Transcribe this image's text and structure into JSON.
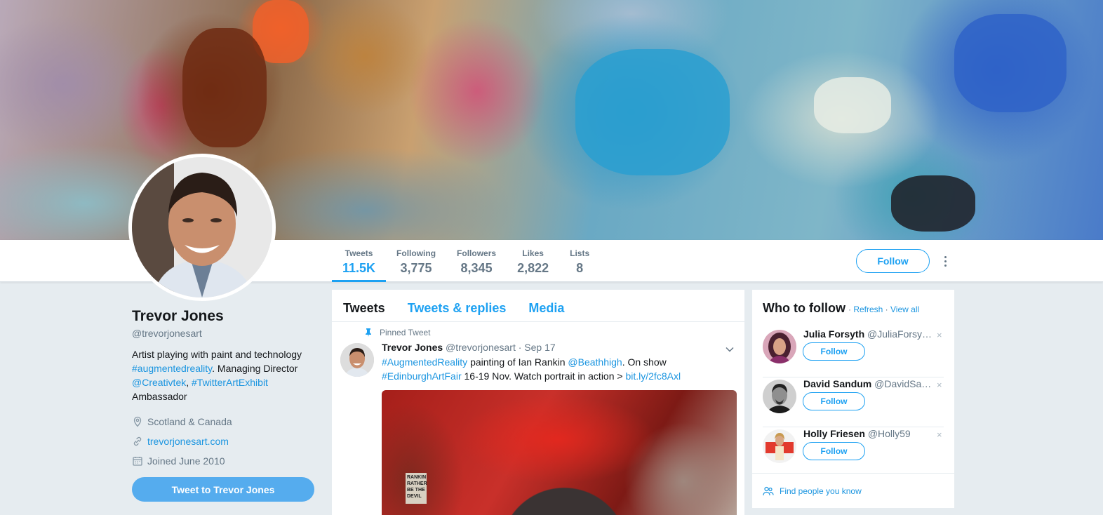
{
  "profile": {
    "name": "Trevor Jones",
    "handle": "@trevorjonesart",
    "bio": {
      "line1": "Artist playing with paint and technology",
      "tag1": "#augmentedreality",
      "mid1": ". Managing Director",
      "mention1": "@Creativtek",
      "comma": ", ",
      "tag2": "#TwitterArtExhibit",
      "line4": "Ambassador"
    },
    "location": "Scotland & Canada",
    "website": "trevorjonesart.com",
    "joined": "Joined June 2010",
    "tweet_to_label": "Tweet to Trevor Jones"
  },
  "stats": [
    {
      "label": "Tweets",
      "value": "11.5K"
    },
    {
      "label": "Following",
      "value": "3,775"
    },
    {
      "label": "Followers",
      "value": "8,345"
    },
    {
      "label": "Likes",
      "value": "2,822"
    },
    {
      "label": "Lists",
      "value": "8"
    }
  ],
  "follow_label": "Follow",
  "timeline": {
    "tabs": [
      "Tweets",
      "Tweets & replies",
      "Media"
    ],
    "pinned_label": "Pinned Tweet",
    "tweet": {
      "name": "Trevor Jones",
      "handle": "@trevorjonesart",
      "date": "· Sep 17",
      "t1": "#AugmentedReality",
      "t2": " painting of Ian Rankin ",
      "t3": "@Beathhigh",
      "t4": ". On show ",
      "t5": "#EdinburghArtFair",
      "t6": " 16-19 Nov. Watch portrait in action > ",
      "t7": "bit.ly/2fc8Axl",
      "media_text": "RANKIN RATHER BE THE DEVIL"
    }
  },
  "who_to_follow": {
    "title": "Who to follow",
    "sep": " · ",
    "refresh": "Refresh",
    "view_all": "View all",
    "suggestions": [
      {
        "name": "Julia Forsyth",
        "handle": "@JuliaForsy…",
        "button": "Follow"
      },
      {
        "name": "David Sandum",
        "handle": "@DavidSa…",
        "button": "Follow"
      },
      {
        "name": "Holly Friesen",
        "handle": "@Holly59",
        "button": "Follow"
      }
    ],
    "close": "×",
    "find_people": "Find people you know"
  },
  "colors": {
    "accent": "#1da1f2",
    "link": "#1b95e0",
    "tweet_to_bg": "#55acee"
  },
  "icons": [
    "location-icon",
    "link-icon",
    "calendar-icon",
    "pin-icon",
    "chevron-down-icon",
    "people-icon",
    "more-icon"
  ]
}
